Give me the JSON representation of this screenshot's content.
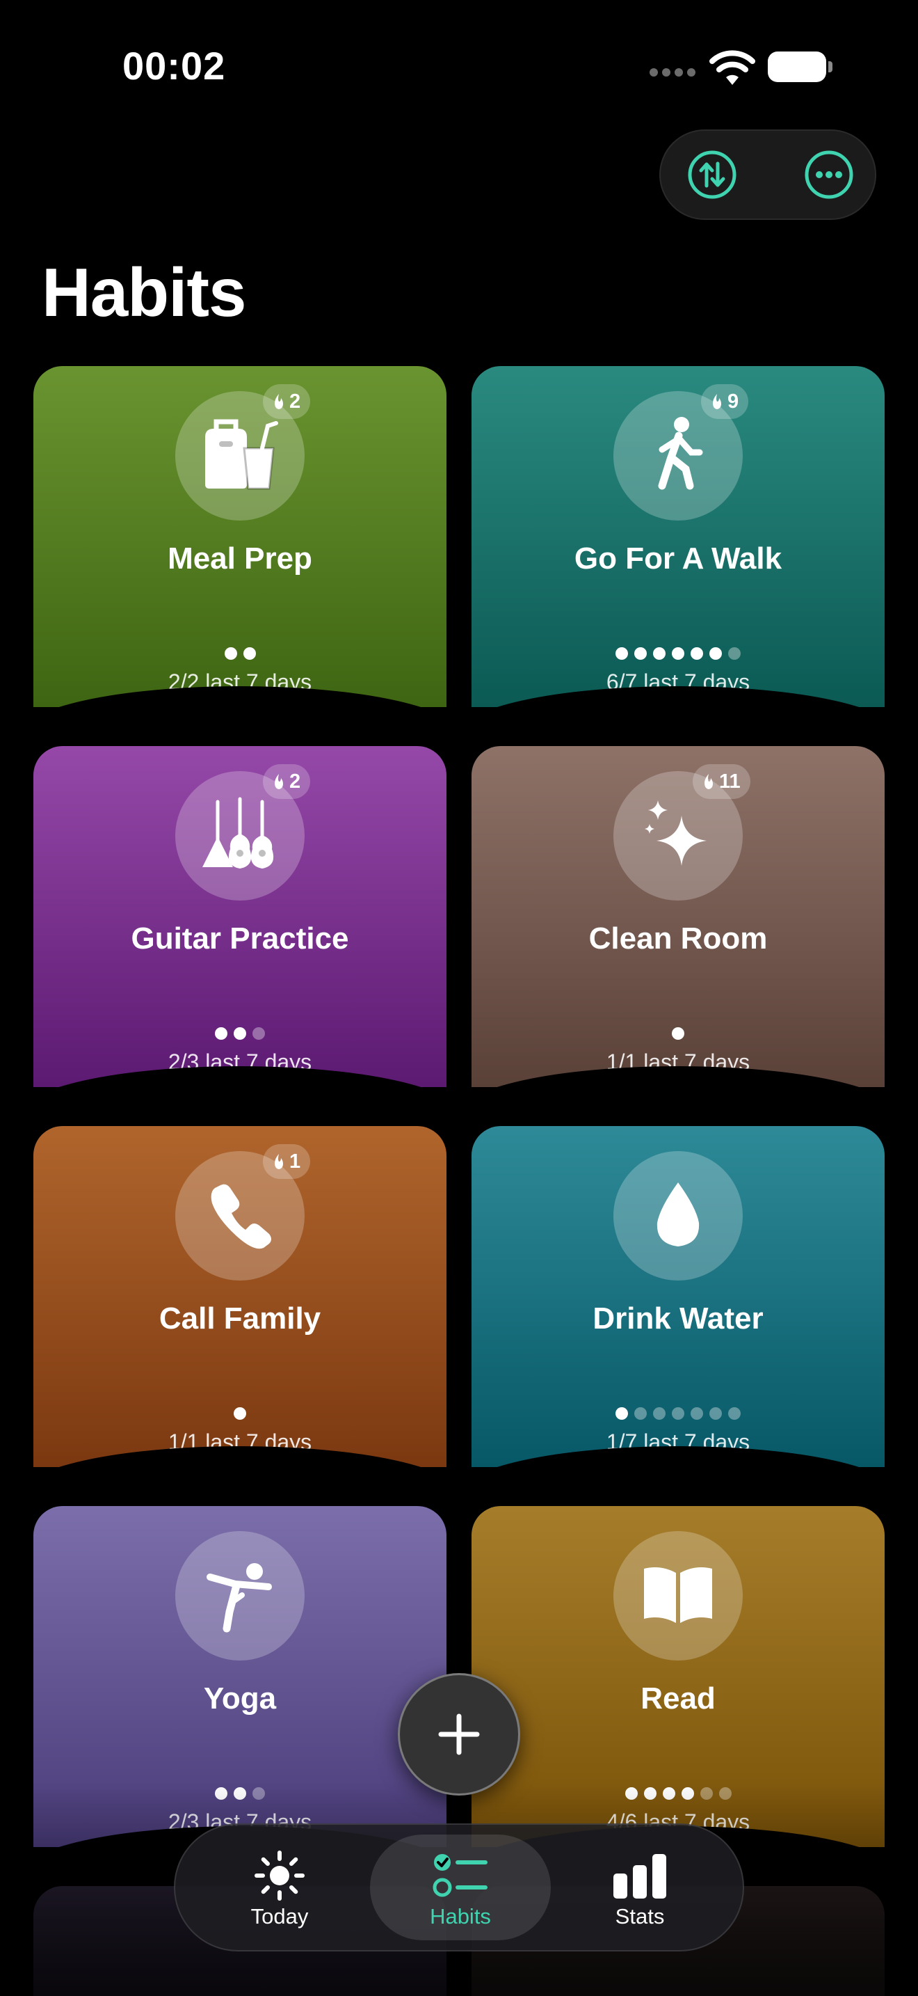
{
  "status": {
    "time": "00:02"
  },
  "header": {
    "title": "Habits",
    "sort_icon": "sort-arrows-icon",
    "more_icon": "ellipsis-icon"
  },
  "colors": {
    "accent": "#3fd3b0"
  },
  "habits": [
    {
      "name": "Meal Prep",
      "icon": "lunch-bag-icon",
      "streak": "2",
      "dots": [
        1,
        1
      ],
      "progress": "2/2 last 7 days",
      "color_top": "#6a9430",
      "color_bottom": "#3e6512"
    },
    {
      "name": "Go For A Walk",
      "icon": "walking-person-icon",
      "streak": "9",
      "dots": [
        1,
        1,
        1,
        1,
        1,
        1,
        0
      ],
      "progress": "6/7 last 7 days",
      "color_top": "#2a8a80",
      "color_bottom": "#0b5a54"
    },
    {
      "name": "Guitar Practice",
      "icon": "guitars-icon",
      "streak": "2",
      "dots": [
        1,
        1,
        0
      ],
      "progress": "2/3 last 7 days",
      "color_top": "#9548a8",
      "color_bottom": "#5c1a72"
    },
    {
      "name": "Clean Room",
      "icon": "sparkles-icon",
      "streak": "11",
      "dots": [
        1
      ],
      "progress": "1/1 last 7 days",
      "color_top": "#8e7268",
      "color_bottom": "#5a4138"
    },
    {
      "name": "Call Family",
      "icon": "phone-icon",
      "streak": "1",
      "dots": [
        1
      ],
      "progress": "1/1 last 7 days",
      "color_top": "#b0652c",
      "color_bottom": "#7b3810"
    },
    {
      "name": "Drink Water",
      "icon": "water-drop-icon",
      "streak": "",
      "dots": [
        1,
        0,
        0,
        0,
        0,
        0,
        0
      ],
      "progress": "1/7 last 7 days",
      "color_top": "#2e8a98",
      "color_bottom": "#075866"
    },
    {
      "name": "Yoga",
      "icon": "yoga-pose-icon",
      "streak": "",
      "dots": [
        1,
        1,
        0
      ],
      "progress": "2/3 last 7 days",
      "color_top": "#7b6eaa",
      "color_bottom": "#4a3c7a"
    },
    {
      "name": "Read",
      "icon": "open-book-icon",
      "streak": "",
      "dots": [
        1,
        1,
        1,
        1,
        0,
        0
      ],
      "progress": "4/6 last 7 days",
      "color_top": "#a57d2a",
      "color_bottom": "#7a5208"
    }
  ],
  "tabs": [
    {
      "label": "Today",
      "icon": "sun-icon"
    },
    {
      "label": "Habits",
      "icon": "checklist-icon"
    },
    {
      "label": "Stats",
      "icon": "bar-chart-icon"
    }
  ]
}
